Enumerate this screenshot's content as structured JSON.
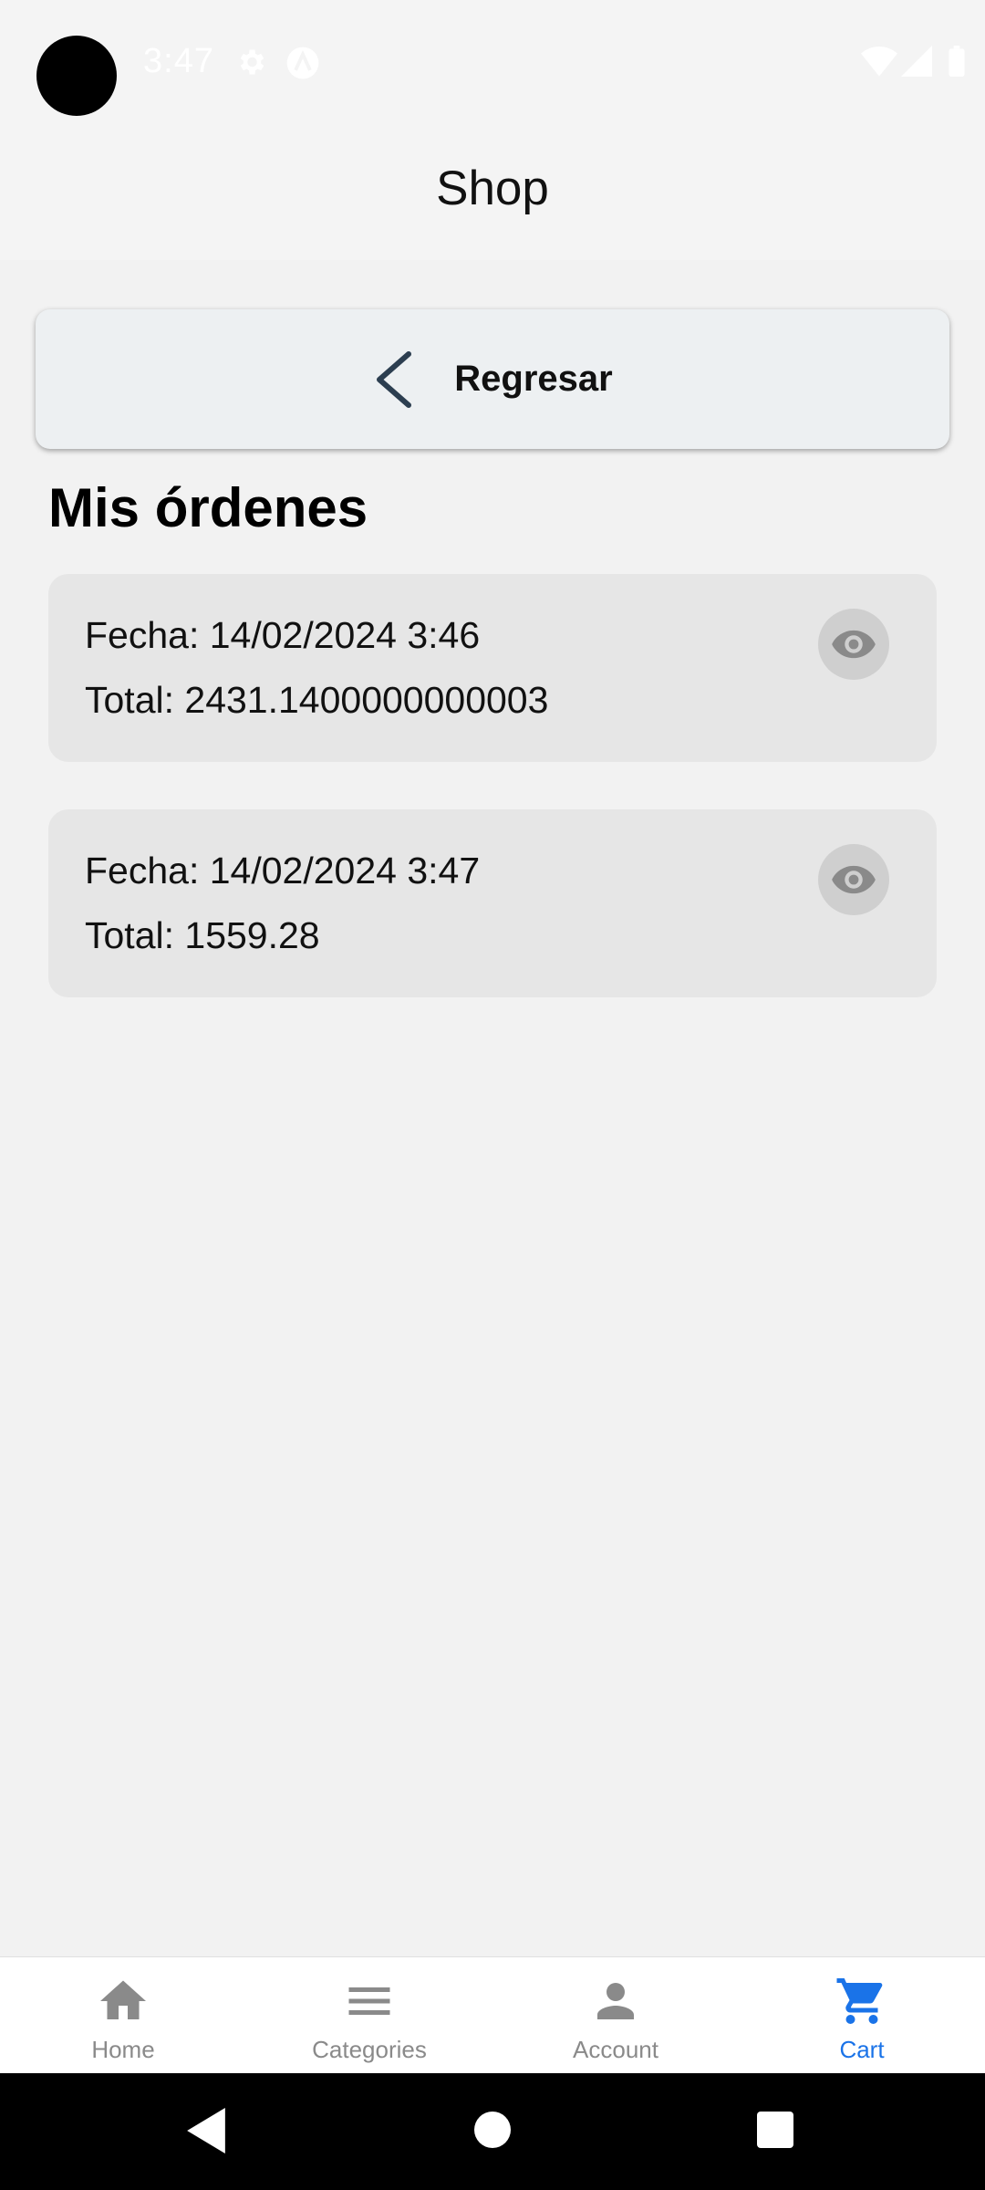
{
  "status_bar": {
    "time": "3:47",
    "icons": [
      "settings-icon",
      "a-logo-icon",
      "wifi-icon",
      "signal-icon",
      "battery-icon"
    ]
  },
  "header": {
    "title": "Shop"
  },
  "back_button": {
    "label": "Regresar",
    "icon": "chevron-left-icon"
  },
  "page": {
    "title": "Mis órdenes"
  },
  "orders": [
    {
      "fecha": "Fecha: 14/02/2024 3:46",
      "total": "Total: 2431.1400000000003",
      "action_icon": "eye-icon"
    },
    {
      "fecha": "Fecha: 14/02/2024 3:47",
      "total": "Total: 1559.28",
      "action_icon": "eye-icon"
    }
  ],
  "bottom_nav": {
    "items": [
      {
        "label": "Home",
        "icon": "home-icon",
        "active": false
      },
      {
        "label": "Categories",
        "icon": "menu-icon",
        "active": false
      },
      {
        "label": "Account",
        "icon": "person-icon",
        "active": false
      },
      {
        "label": "Cart",
        "icon": "cart-icon",
        "active": true
      }
    ],
    "active_color": "#1a73e8",
    "inactive_color": "#8a8a8a"
  },
  "system_nav": {
    "buttons": [
      "back-triangle-icon",
      "home-circle-icon",
      "recents-square-icon"
    ]
  }
}
